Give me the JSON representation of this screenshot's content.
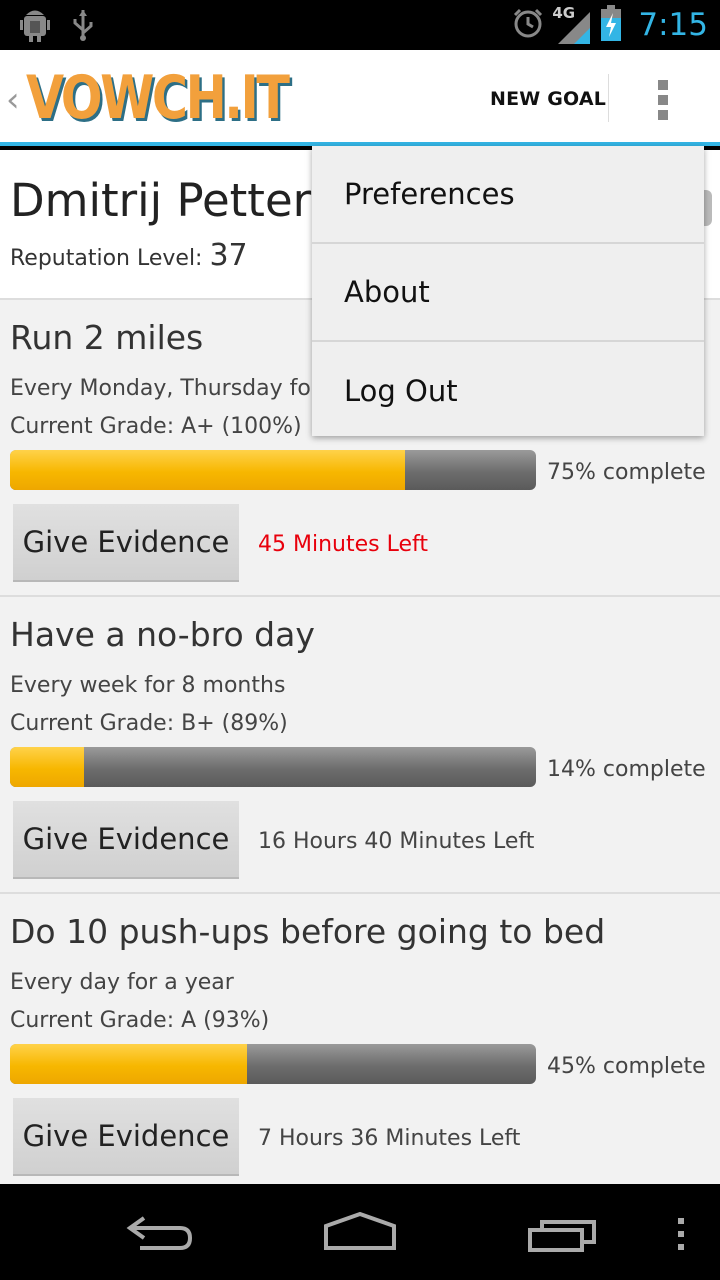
{
  "app": {
    "title": "VOWCH.IT",
    "back_glyph": "‹",
    "actions": {
      "new_goal": "NEW GOAL"
    }
  },
  "status_bar": {
    "time": "7:15",
    "network": "4G",
    "icons": [
      "android-debug-icon",
      "usb-icon",
      "alarm-icon",
      "signal-icon",
      "battery-charging-icon"
    ],
    "accent_color": "#33b5e5"
  },
  "profile": {
    "name": "Dmitrij Petters",
    "reputation_label": "Reputation Level:",
    "reputation_value": "37"
  },
  "goals": [
    {
      "title": "Run 2 miles",
      "schedule": "Every Monday, Thursday for",
      "grade": "Current Grade:  A+ (100%)",
      "progress": 0.75,
      "progress_text": "75% complete",
      "button": "Give Evidence",
      "time_left": "45 Minutes Left",
      "urgent": true
    },
    {
      "title": "Have a no-bro day",
      "schedule": "Every week for 8 months",
      "grade": "Current Grade:  B+ (89%)",
      "progress": 0.14,
      "progress_text": "14% complete",
      "button": "Give Evidence",
      "time_left": "16 Hours 40 Minutes Left",
      "urgent": false
    },
    {
      "title": "Do 10 push-ups before going to bed",
      "schedule": "Every day for a year",
      "grade": "Current Grade:  A (93%)",
      "progress": 0.45,
      "progress_text": "45% complete",
      "button": "Give Evidence",
      "time_left": "7 Hours 36 Minutes Left",
      "urgent": false
    }
  ],
  "overflow_menu": {
    "items": [
      "Preferences",
      "About",
      "Log Out"
    ]
  },
  "colors": {
    "progress_fill": "#f7b700",
    "progress_track": "#6d6d6d",
    "urgent_text": "#e8000c",
    "logo_orange": "#f2a03c",
    "logo_shadow": "#2d6f86"
  }
}
